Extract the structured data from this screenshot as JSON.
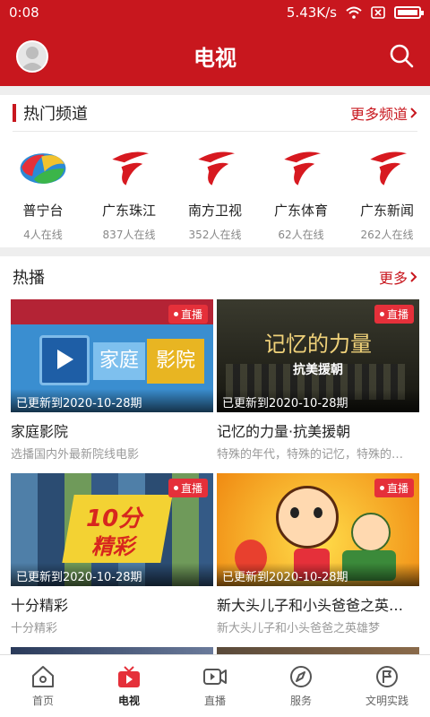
{
  "status": {
    "time": "0:08",
    "speed": "5.43K/s"
  },
  "header": {
    "title": "电视"
  },
  "hot_channels": {
    "title": "热门频道",
    "more": "更多频道",
    "items": [
      {
        "name": "普宁台",
        "online": "4人在线"
      },
      {
        "name": "广东珠江",
        "online": "837人在线"
      },
      {
        "name": "南方卫视",
        "online": "352人在线"
      },
      {
        "name": "广东体育",
        "online": "62人在线"
      },
      {
        "name": "广东新闻",
        "online": "262人在线"
      }
    ]
  },
  "hot_play": {
    "title": "热播",
    "more": "更多",
    "live_label": "直播",
    "cards": [
      {
        "title": "家庭影院",
        "subtitle": "选播国内外最新院线电影",
        "update": "已更新到2020-10-28期",
        "thumb_text_a": "家庭",
        "thumb_text_b": "影院"
      },
      {
        "title": "记忆的力量·抗美援朝",
        "subtitle": "特殊的年代，特殊的记忆，特殊的…",
        "update": "已更新到2020-10-28期",
        "thumb_text_a": "记忆的力量",
        "thumb_text_b": "抗美援朝"
      },
      {
        "title": "十分精彩",
        "subtitle": "十分精彩",
        "update": "已更新到2020-10-28期",
        "thumb_text_a": "10分",
        "thumb_text_b": "精彩"
      },
      {
        "title": "新大头儿子和小头爸爸之英…",
        "subtitle": "新大头儿子和小头爸爸之英雄梦",
        "update": "已更新到2020-10-28期"
      }
    ]
  },
  "tabs": [
    {
      "label": "首页"
    },
    {
      "label": "电视"
    },
    {
      "label": "直播"
    },
    {
      "label": "服务"
    },
    {
      "label": "文明实践"
    }
  ],
  "colors": {
    "brand": "#c8171e",
    "badge": "#e5303a"
  }
}
